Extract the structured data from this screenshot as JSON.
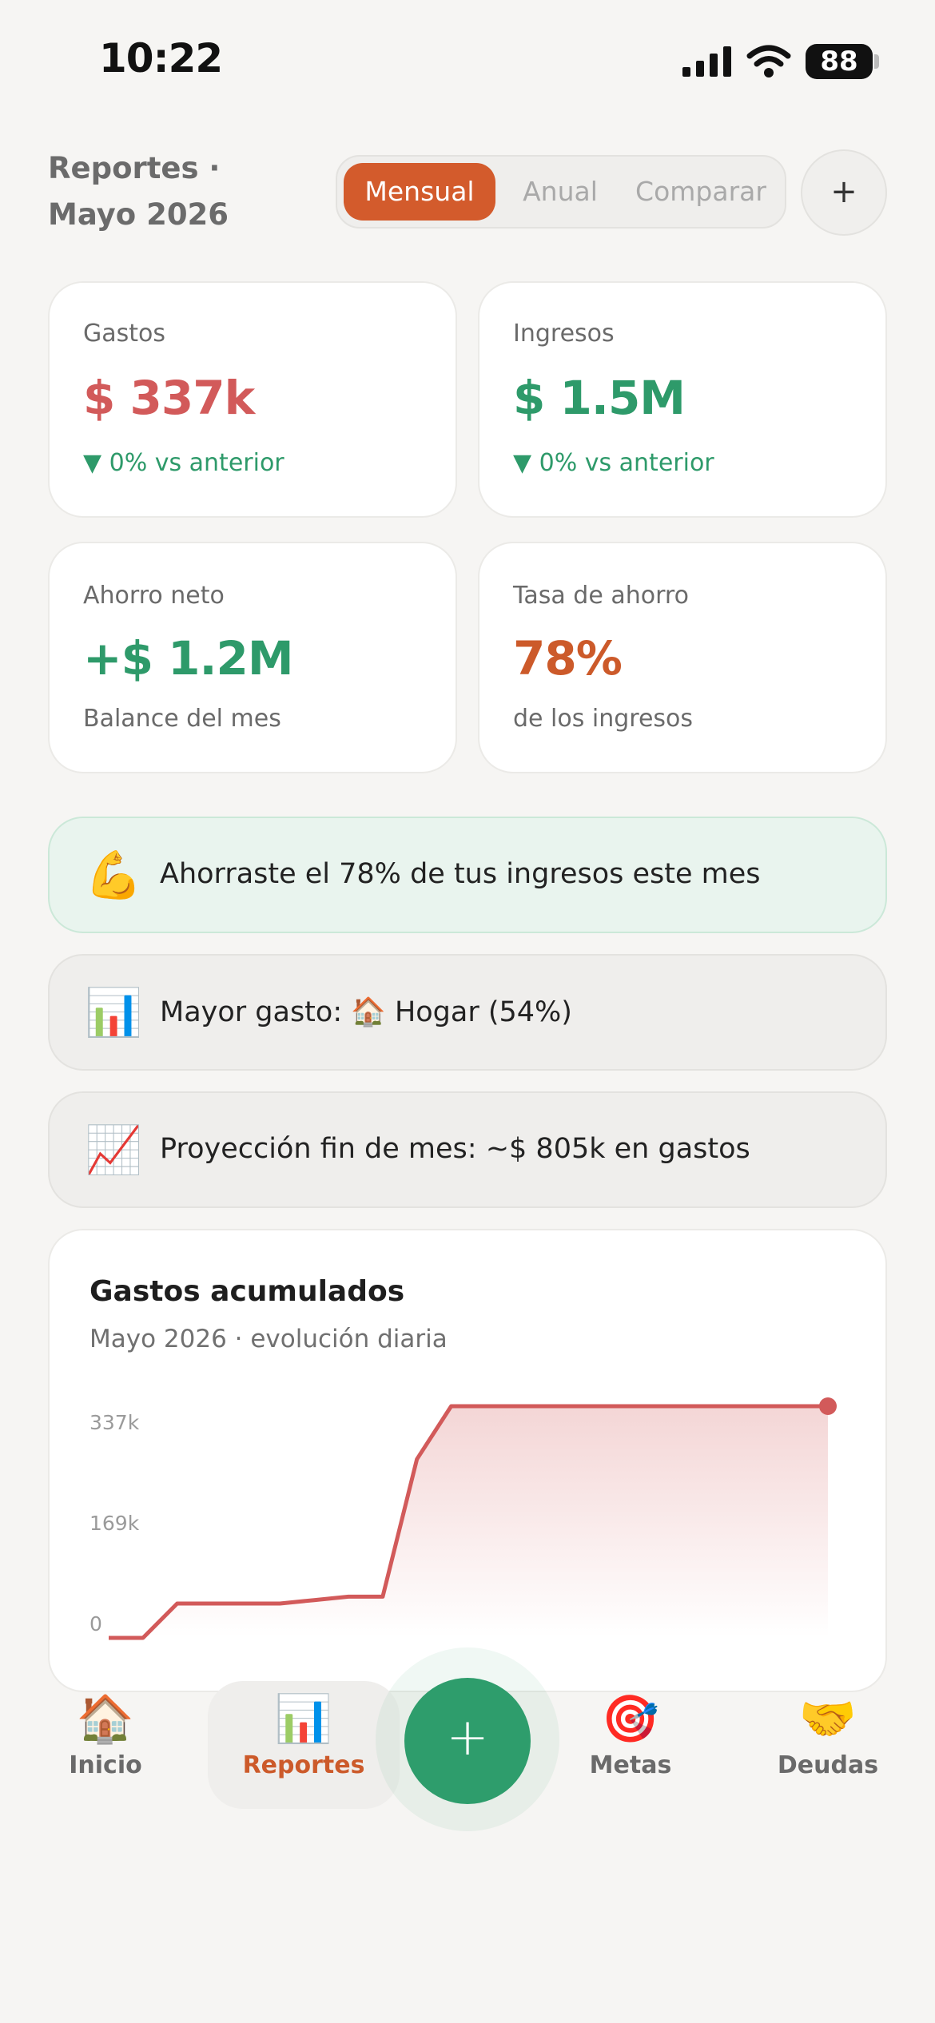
{
  "status_bar": {
    "time": "10:22",
    "battery": "88"
  },
  "header": {
    "title": "Reportes · Mayo 2026",
    "tabs": [
      {
        "label": "Mensual",
        "active": true
      },
      {
        "label": "Anual",
        "active": false
      },
      {
        "label": "Comparar",
        "active": false
      }
    ],
    "add_label": "+"
  },
  "stats": {
    "gastos": {
      "label": "Gastos",
      "value": "$ 337k",
      "delta": "▼ 0% vs anterior"
    },
    "ingresos": {
      "label": "Ingresos",
      "value": "$ 1.5M",
      "delta": "▼ 0% vs anterior"
    },
    "ahorro_neto": {
      "label": "Ahorro neto",
      "value": "+$ 1.2M",
      "sub": "Balance del mes"
    },
    "tasa_ahorro": {
      "label": "Tasa de ahorro",
      "value": "78%",
      "sub": "de los ingresos"
    }
  },
  "insights": [
    {
      "icon": "💪",
      "text": "Ahorraste el 78% de tus ingresos este mes"
    },
    {
      "icon": "📊",
      "text": "Mayor gasto: 🏠 Hogar (54%)"
    },
    {
      "icon": "📈",
      "text": "Proyección fin de mes: ~$ 805k en gastos"
    }
  ],
  "chart_card": {
    "title": "Gastos acumulados",
    "subtitle": "Mayo 2026 · evolución diaria"
  },
  "chart_data": {
    "type": "area",
    "title": "Gastos acumulados",
    "subtitle": "Mayo 2026 · evolución diaria",
    "y_tick_labels": [
      "337k",
      "169k",
      "0"
    ],
    "y_ticks": [
      337,
      169,
      0
    ],
    "ylim": [
      0,
      337
    ],
    "x": [
      1,
      2,
      3,
      4,
      5,
      6,
      7,
      8,
      9,
      10,
      11,
      12,
      13,
      14,
      15,
      16,
      17,
      18,
      19,
      20,
      21,
      22
    ],
    "series": [
      {
        "values": [
          0,
          0,
          50,
          50,
          50,
          50,
          55,
          60,
          60,
          260,
          337,
          337,
          337,
          337,
          337,
          337,
          337,
          337,
          337,
          337,
          337,
          337
        ]
      }
    ],
    "color": "#d25a5a",
    "grid": false
  },
  "nav": {
    "items": [
      {
        "icon": "🏠",
        "label": "Inicio",
        "active": false
      },
      {
        "icon": "📊",
        "label": "Reportes",
        "active": true
      },
      {
        "icon": "🎯",
        "label": "Metas",
        "active": false
      },
      {
        "icon": "🤝",
        "label": "Deudas",
        "active": false
      }
    ],
    "fab_label": "+",
    "active_color": "#cc5a2a"
  }
}
